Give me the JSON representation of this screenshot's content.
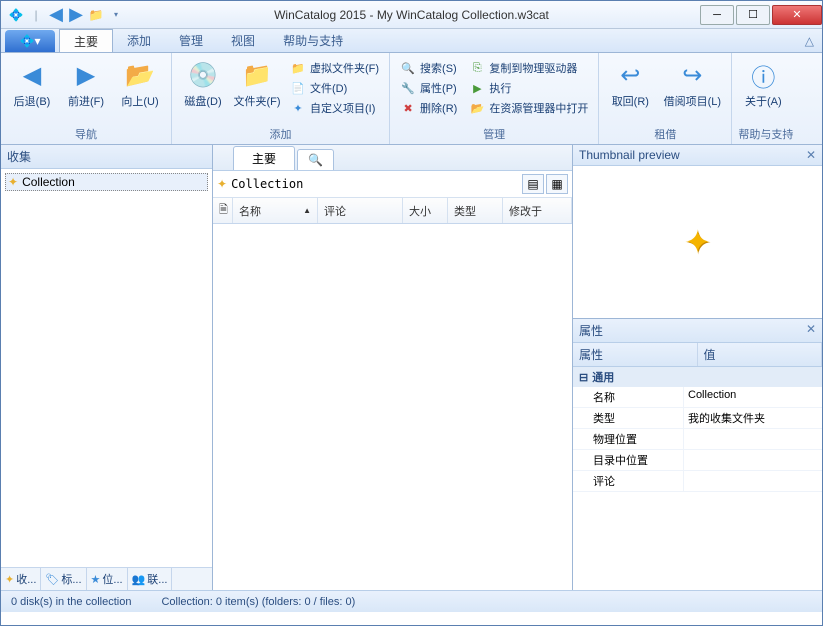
{
  "title": "WinCatalog 2015 - My WinCatalog Collection.w3cat",
  "tabs": {
    "main": "主要",
    "add": "添加",
    "manage": "管理",
    "view": "视图",
    "help": "帮助与支持"
  },
  "ribbon": {
    "nav": {
      "back": "后退(B)",
      "fwd": "前进(F)",
      "up": "向上(U)",
      "label": "导航"
    },
    "add": {
      "disk": "磁盘(D)",
      "folder": "文件夹(F)",
      "vfolder": "虚拟文件夹(F)",
      "file": "文件(D)",
      "custom": "自定义项目(I)",
      "label": "添加"
    },
    "manage": {
      "search": "搜索(S)",
      "props": "属性(P)",
      "delete": "删除(R)",
      "copy": "复制到物理驱动器",
      "exec": "执行",
      "explorer": "在资源管理器中打开",
      "label": "管理"
    },
    "rent": {
      "take": "取回(R)",
      "loan": "借阅项目(L)",
      "label": "租借"
    },
    "help": {
      "about": "关于(A)",
      "label": "帮助与支持"
    }
  },
  "left": {
    "header": "收集",
    "node": "Collection",
    "tabs": {
      "coll": "收...",
      "tags": "标...",
      "loc": "位...",
      "cont": "联..."
    }
  },
  "center": {
    "tab": "主要",
    "path": "Collection",
    "cols": {
      "name": "名称",
      "comment": "评论",
      "size": "大小",
      "type": "类型",
      "modified": "修改于"
    }
  },
  "right": {
    "thumb": "Thumbnail preview",
    "props": "属性",
    "col_prop": "属性",
    "col_val": "值",
    "group": "通用",
    "rows": {
      "name_k": "名称",
      "name_v": "Collection",
      "type_k": "类型",
      "type_v": "我的收集文件夹",
      "phys_k": "物理位置",
      "phys_v": "",
      "catpos_k": "目录中位置",
      "catpos_v": "",
      "comment_k": "评论",
      "comment_v": ""
    }
  },
  "status": {
    "disks": "0 disk(s) in the collection",
    "coll": "Collection: 0 item(s) (folders: 0 / files: 0)"
  }
}
